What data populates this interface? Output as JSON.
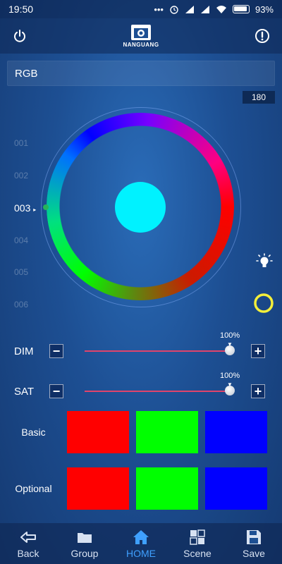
{
  "status_bar": {
    "time": "19:50",
    "dots": "•••",
    "battery_pct": "93%"
  },
  "header": {
    "logo_text": "NANGUANG",
    "power_icon": "power-icon",
    "info_icon": "exclamation-circle-icon"
  },
  "mode": {
    "label": "RGB"
  },
  "hue_value": "180",
  "presets": [
    {
      "label": "001",
      "active": false
    },
    {
      "label": "002",
      "active": false
    },
    {
      "label": "003",
      "active": true
    },
    {
      "label": "004",
      "active": false
    },
    {
      "label": "005",
      "active": false
    },
    {
      "label": "006",
      "active": false
    }
  ],
  "wheel": {
    "center_color": "#00f2ff"
  },
  "side_icons": [
    "light-bulb-icon",
    "color-ring-icon"
  ],
  "dim": {
    "label": "DIM",
    "percent_text": "100%",
    "level": 1.0
  },
  "sat": {
    "label": "SAT",
    "percent_text": "100%",
    "level": 1.0
  },
  "swatches": {
    "basic": {
      "label": "Basic",
      "colors": [
        "#ff0000",
        "#00ff00",
        "#0000ff"
      ]
    },
    "optional": {
      "label": "Optional",
      "colors": [
        "#ff0000",
        "#00ff00",
        "#0000ff"
      ]
    }
  },
  "nav": [
    {
      "label": "Back",
      "icon": "back-arrow-icon",
      "active": false
    },
    {
      "label": "Group",
      "icon": "folder-icon",
      "active": false
    },
    {
      "label": "HOME",
      "icon": "home-icon",
      "active": true
    },
    {
      "label": "Scene",
      "icon": "grid-icon",
      "active": false
    },
    {
      "label": "Save",
      "icon": "save-icon",
      "active": false
    }
  ],
  "colors": {
    "accent": "#3fa0ff",
    "slider_track": "#e0446b"
  }
}
